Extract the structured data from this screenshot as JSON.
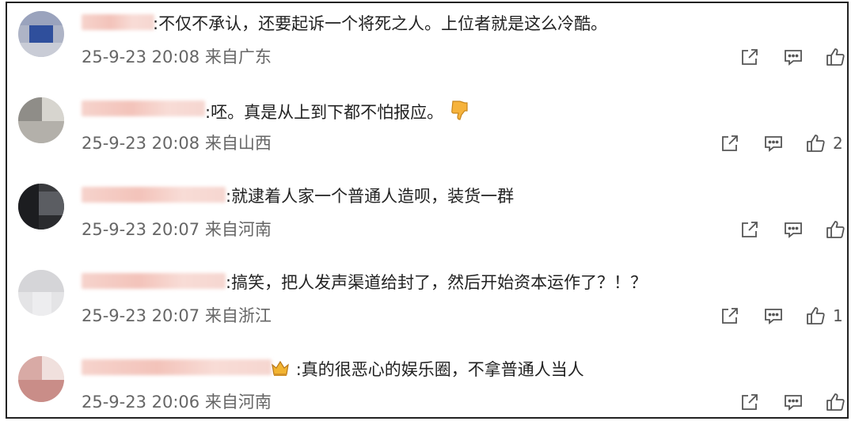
{
  "comments": [
    {
      "text": ":不仅不承认，还要起诉一个将死之人。上位者就是这么冷酷。",
      "time": "25-9-23 20:08",
      "location": "来自广东",
      "likes": ""
    },
    {
      "text": ":呸。真是从上到下都不怕报应。",
      "emoji": "thumbs-down-emoji",
      "time": "25-9-23 20:08",
      "location": "来自山西",
      "likes": "2"
    },
    {
      "text": ":就逮着人家一个普通人造呗，装货一群",
      "time": "25-9-23 20:07",
      "location": "来自河南",
      "likes": ""
    },
    {
      "text": ":搞笑，把人发声渠道给封了，然后开始资本运作了？！？",
      "time": "25-9-23 20:07",
      "location": "来自浙江",
      "likes": "1"
    },
    {
      "text": ":真的很恶心的娱乐圈，不拿普通人当人",
      "badge": "crown-badge-icon",
      "time": "25-9-23 20:06",
      "location": "来自河南",
      "likes": ""
    }
  ],
  "icons": {
    "share": "share-icon",
    "reply": "comment-icon",
    "like": "thumbs-up-icon"
  },
  "colors": {
    "text": "#222222",
    "meta": "#666666",
    "icon": "#555555",
    "border": "#222222"
  }
}
